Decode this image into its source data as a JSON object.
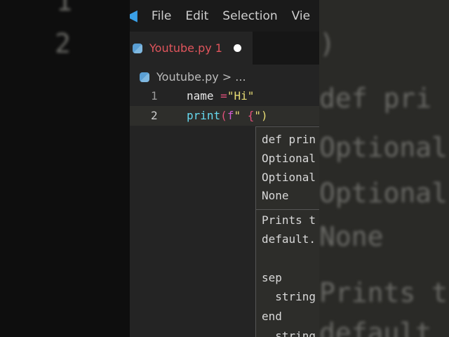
{
  "background_left": {
    "lines": [
      "1",
      "2"
    ]
  },
  "background_right": {
    "lines": [
      ")",
      "def pri",
      "Optional",
      "Optional",
      "None",
      "Prints t",
      "default"
    ]
  },
  "titlebar": {
    "menu": [
      "File",
      "Edit",
      "Selection",
      "Vie"
    ]
  },
  "tab": {
    "label": "Youtube.py",
    "problems": "1"
  },
  "breadcrumb": {
    "file": "Youtube.py",
    "sep": ">",
    "more": "..."
  },
  "code": [
    {
      "num": "1",
      "tokens": [
        {
          "t": "name ",
          "c": "#e8e8e8"
        },
        {
          "t": "=",
          "c": "#e0507a"
        },
        {
          "t": "\"Hi\"",
          "c": "#e6db74"
        }
      ]
    },
    {
      "num": "2",
      "tokens": [
        {
          "t": "print",
          "c": "#66d9ef"
        },
        {
          "t": "(",
          "c": "#e0507a"
        },
        {
          "t": "f",
          "c": "#cf5bd0"
        },
        {
          "t": "\"",
          "c": "#e6db74"
        },
        {
          "t": " {",
          "c": "#e0507a"
        },
        {
          "t": "\")",
          "c": "#e6db74"
        }
      ]
    }
  ],
  "hover": {
    "signature": [
      "def prin",
      "Optional",
      "Optional",
      "None"
    ],
    "doc": [
      "Prints t",
      "default.",
      "",
      "sep",
      "  string",
      "end",
      "  string"
    ]
  }
}
